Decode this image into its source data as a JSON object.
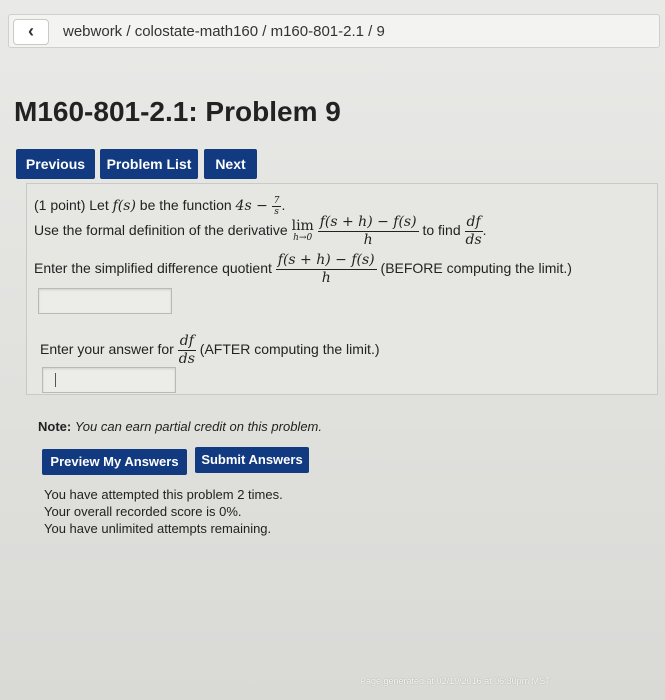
{
  "nav": {
    "back_icon": "‹",
    "breadcrumb": "webwork / colostate-math160 / m160-801-2.1 / 9"
  },
  "page_title": "M160-801-2.1: Problem 9",
  "buttons": {
    "previous": "Previous",
    "problem_list": "Problem List",
    "next": "Next",
    "preview": "Preview My Answers",
    "submit": "Submit Answers"
  },
  "problem": {
    "line1_prefix": "(1 point) Let",
    "line1_fs": "f(s)",
    "line1_mid": "be the function",
    "line1_expr": "4s −",
    "line1_frac_num": "7",
    "line1_frac_den": "s",
    "line2_prefix": "Use the formal definition of the derivative",
    "lim_word": "lim",
    "lim_sub": "h→0",
    "diff_num": "f(s + h) − f(s)",
    "diff_den": "h",
    "line2_to_find": "to find",
    "deriv_num": "df",
    "deriv_den": "ds",
    "line3_prefix": "Enter the simplified difference quotient",
    "line3_suffix": "(BEFORE computing the limit.)",
    "line4_prefix": "Enter your answer for",
    "line4_suffix": "(AFTER computing the limit.)"
  },
  "inputs": {
    "difference_quotient_value": "",
    "derivative_value": ""
  },
  "note": {
    "label": "Note:",
    "text": "You can earn partial credit on this problem."
  },
  "status": {
    "attempts": "You have attempted this problem 2 times.",
    "score": "Your overall recorded score is 0%.",
    "remaining": "You have unlimited attempts remaining."
  },
  "footer": "Page generated at 02/19/2016 at 06:30pm MST",
  "colors": {
    "button_bg": "#123a80",
    "button_text": "#ffffff"
  }
}
